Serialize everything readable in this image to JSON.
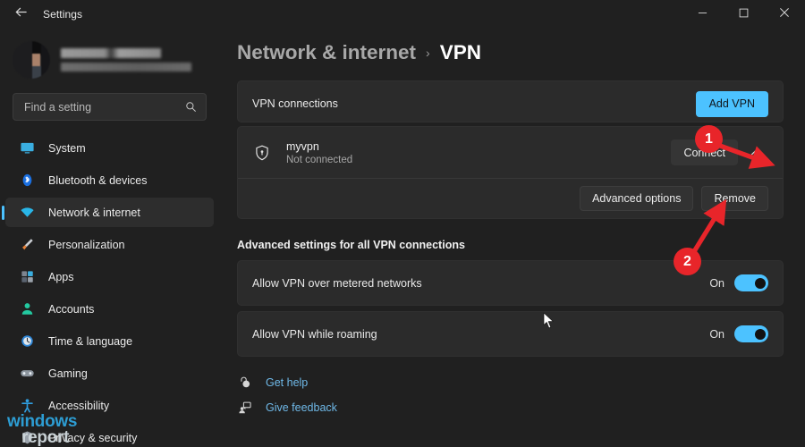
{
  "window": {
    "title": "Settings",
    "back_icon": "arrow-left-icon",
    "controls": [
      {
        "name": "minimize",
        "icon": "minimize-icon"
      },
      {
        "name": "maximize",
        "icon": "maximize-icon"
      },
      {
        "name": "close",
        "icon": "close-icon"
      }
    ]
  },
  "sidebar": {
    "profile": {
      "name_redacted": "",
      "email_redacted": "",
      "avatar": "user-avatar"
    },
    "search": {
      "placeholder": "Find a setting",
      "icon": "search-icon"
    },
    "items": [
      {
        "label": "System",
        "icon": "monitor-icon",
        "active": false
      },
      {
        "label": "Bluetooth & devices",
        "icon": "bluetooth-icon",
        "active": false
      },
      {
        "label": "Network & internet",
        "icon": "wifi-icon",
        "active": true
      },
      {
        "label": "Personalization",
        "icon": "paintbrush-icon",
        "active": false
      },
      {
        "label": "Apps",
        "icon": "apps-icon",
        "active": false
      },
      {
        "label": "Accounts",
        "icon": "person-icon",
        "active": false
      },
      {
        "label": "Time & language",
        "icon": "clock-icon",
        "active": false
      },
      {
        "label": "Gaming",
        "icon": "gamepad-icon",
        "active": false
      },
      {
        "label": "Accessibility",
        "icon": "accessibility-icon",
        "active": false
      },
      {
        "label": "Privacy & security",
        "icon": "shield-icon",
        "active": false
      }
    ],
    "watermark": {
      "line1": "windows",
      "line2": "report"
    }
  },
  "breadcrumb": {
    "parent": "Network & internet",
    "separator": "›",
    "current": "VPN"
  },
  "vpn_connections": {
    "title": "VPN connections",
    "add_button": "Add VPN"
  },
  "vpn_profile": {
    "icon": "vpn-shield-icon",
    "name": "myvpn",
    "status": "Not connected",
    "connect_button": "Connect",
    "collapse_icon": "chevron-up-icon",
    "advanced_options_button": "Advanced options",
    "remove_button": "Remove"
  },
  "advanced": {
    "heading": "Advanced settings for all VPN connections",
    "settings": [
      {
        "label": "Allow VPN over metered networks",
        "state": "On",
        "enabled": true
      },
      {
        "label": "Allow VPN while roaming",
        "state": "On",
        "enabled": true
      }
    ]
  },
  "links": [
    {
      "label": "Get help",
      "icon": "help-icon"
    },
    {
      "label": "Give feedback",
      "icon": "feedback-icon"
    }
  ],
  "annotations": [
    {
      "number": "1",
      "target": "chevron-up-icon"
    },
    {
      "number": "2",
      "target": "remove-button"
    }
  ],
  "colors": {
    "accent": "#4cc2ff",
    "annotation": "#e8252a",
    "window_bg": "#202020",
    "card_bg": "#2b2b2b",
    "link": "#6fb9e8"
  }
}
